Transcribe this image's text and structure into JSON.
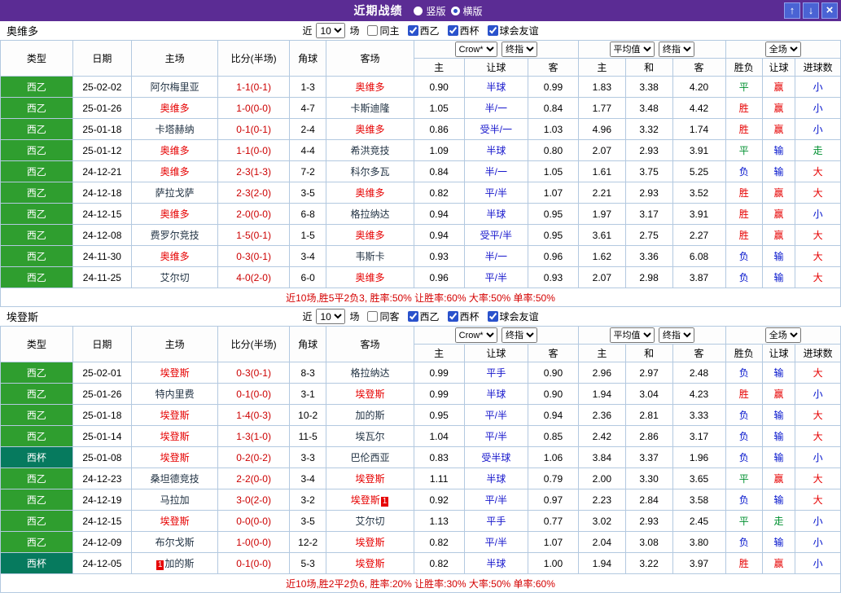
{
  "titlebar": {
    "title": "近期战绩",
    "radios": [
      {
        "label": "竖版",
        "selected": false
      },
      {
        "label": "横版",
        "selected": true
      }
    ],
    "up_icon": "↑",
    "down_icon": "↓",
    "close_icon": "×"
  },
  "labels": {
    "recent": "近",
    "matches": "场"
  },
  "header": {
    "type": "类型",
    "date": "日期",
    "home": "主场",
    "score": "比分(半场)",
    "corner": "角球",
    "away": "客场",
    "odds_select1": "Crow*",
    "odds_select2": "终指",
    "odds_home": "主",
    "odds_handicap": "让球",
    "odds_away": "客",
    "avg_select1": "平均值",
    "avg_select2": "终指",
    "avg_home": "主",
    "avg_draw": "和",
    "avg_away": "客",
    "result_select": "全场",
    "res_wdl": "胜负",
    "res_handicap": "让球",
    "res_goals": "进球数"
  },
  "colors": {
    "titlebar": "#5b2c94",
    "button_blue": "#4a63d4",
    "league_green": "#2f9e2f",
    "cup_teal": "#067a5e",
    "win_red": "#e60000",
    "lose_blue": "#0011cc",
    "draw_green": "#009030",
    "score_red": "#cc0000",
    "handicap_blue": "#1515cc"
  },
  "sections": [
    {
      "team": "奥维多",
      "count": "10",
      "checkboxes": [
        {
          "label": "同主",
          "checked": false
        },
        {
          "label": "西乙",
          "checked": true
        },
        {
          "label": "西杯",
          "checked": true
        },
        {
          "label": "球会友谊",
          "checked": true
        }
      ],
      "rows": [
        {
          "lg": "西乙",
          "lgc": "g",
          "date": "25-02-02",
          "home": "阿尔梅里亚",
          "home_f": false,
          "score": "1-1(0-1)",
          "corner": "1-3",
          "away": "奥维多",
          "away_f": true,
          "o1": "0.90",
          "hc": "半球",
          "o2": "0.99",
          "a1": "1.83",
          "a2": "3.38",
          "a3": "4.20",
          "r1": "平",
          "r2": "赢",
          "r3": "小"
        },
        {
          "lg": "西乙",
          "lgc": "g",
          "date": "25-01-26",
          "home": "奥维多",
          "home_f": true,
          "score": "1-0(0-0)",
          "corner": "4-7",
          "away": "卡斯迪隆",
          "away_f": false,
          "o1": "1.05",
          "hc": "半/一",
          "o2": "0.84",
          "a1": "1.77",
          "a2": "3.48",
          "a3": "4.42",
          "r1": "胜",
          "r2": "赢",
          "r3": "小"
        },
        {
          "lg": "西乙",
          "lgc": "g",
          "date": "25-01-18",
          "home": "卡塔赫纳",
          "home_f": false,
          "score": "0-1(0-1)",
          "corner": "2-4",
          "away": "奥维多",
          "away_f": true,
          "o1": "0.86",
          "hc": "受半/一",
          "o2": "1.03",
          "a1": "4.96",
          "a2": "3.32",
          "a3": "1.74",
          "r1": "胜",
          "r2": "赢",
          "r3": "小"
        },
        {
          "lg": "西乙",
          "lgc": "g",
          "date": "25-01-12",
          "home": "奥维多",
          "home_f": true,
          "score": "1-1(0-0)",
          "corner": "4-4",
          "away": "希洪竞技",
          "away_f": false,
          "o1": "1.09",
          "hc": "半球",
          "o2": "0.80",
          "a1": "2.07",
          "a2": "2.93",
          "a3": "3.91",
          "r1": "平",
          "r2": "输",
          "r3": "走"
        },
        {
          "lg": "西乙",
          "lgc": "g",
          "date": "24-12-21",
          "home": "奥维多",
          "home_f": true,
          "score": "2-3(1-3)",
          "corner": "7-2",
          "away": "科尔多瓦",
          "away_f": false,
          "o1": "0.84",
          "hc": "半/一",
          "o2": "1.05",
          "a1": "1.61",
          "a2": "3.75",
          "a3": "5.25",
          "r1": "负",
          "r2": "输",
          "r3": "大"
        },
        {
          "lg": "西乙",
          "lgc": "g",
          "date": "24-12-18",
          "home": "萨拉戈萨",
          "home_f": false,
          "score": "2-3(2-0)",
          "corner": "3-5",
          "away": "奥维多",
          "away_f": true,
          "o1": "0.82",
          "hc": "平/半",
          "o2": "1.07",
          "a1": "2.21",
          "a2": "2.93",
          "a3": "3.52",
          "r1": "胜",
          "r2": "赢",
          "r3": "大"
        },
        {
          "lg": "西乙",
          "lgc": "g",
          "date": "24-12-15",
          "home": "奥维多",
          "home_f": true,
          "score": "2-0(0-0)",
          "corner": "6-8",
          "away": "格拉纳达",
          "away_f": false,
          "o1": "0.94",
          "hc": "半球",
          "o2": "0.95",
          "a1": "1.97",
          "a2": "3.17",
          "a3": "3.91",
          "r1": "胜",
          "r2": "赢",
          "r3": "小"
        },
        {
          "lg": "西乙",
          "lgc": "g",
          "date": "24-12-08",
          "home": "费罗尔竞技",
          "home_f": false,
          "score": "1-5(0-1)",
          "corner": "1-5",
          "away": "奥维多",
          "away_f": true,
          "o1": "0.94",
          "hc": "受平/半",
          "o2": "0.95",
          "a1": "3.61",
          "a2": "2.75",
          "a3": "2.27",
          "r1": "胜",
          "r2": "赢",
          "r3": "大"
        },
        {
          "lg": "西乙",
          "lgc": "g",
          "date": "24-11-30",
          "home": "奥维多",
          "home_f": true,
          "score": "0-3(0-1)",
          "corner": "3-4",
          "away": "韦斯卡",
          "away_f": false,
          "o1": "0.93",
          "hc": "半/一",
          "o2": "0.96",
          "a1": "1.62",
          "a2": "3.36",
          "a3": "6.08",
          "r1": "负",
          "r2": "输",
          "r3": "大"
        },
        {
          "lg": "西乙",
          "lgc": "g",
          "date": "24-11-25",
          "home": "艾尔切",
          "home_f": false,
          "score": "4-0(2-0)",
          "corner": "6-0",
          "away": "奥维多",
          "away_f": true,
          "o1": "0.96",
          "hc": "平/半",
          "o2": "0.93",
          "a1": "2.07",
          "a2": "2.98",
          "a3": "3.87",
          "r1": "负",
          "r2": "输",
          "r3": "大"
        }
      ],
      "summary": "近10场,胜5平2负3, 胜率:50% 让胜率:60% 大率:50% 单率:50%"
    },
    {
      "team": "埃登斯",
      "count": "10",
      "checkboxes": [
        {
          "label": "同客",
          "checked": false
        },
        {
          "label": "西乙",
          "checked": true
        },
        {
          "label": "西杯",
          "checked": true
        },
        {
          "label": "球会友谊",
          "checked": true
        }
      ],
      "rows": [
        {
          "lg": "西乙",
          "lgc": "g",
          "date": "25-02-01",
          "home": "埃登斯",
          "home_f": true,
          "score": "0-3(0-1)",
          "corner": "8-3",
          "away": "格拉纳达",
          "away_f": false,
          "o1": "0.99",
          "hc": "平手",
          "o2": "0.90",
          "a1": "2.96",
          "a2": "2.97",
          "a3": "2.48",
          "r1": "负",
          "r2": "输",
          "r3": "大"
        },
        {
          "lg": "西乙",
          "lgc": "g",
          "date": "25-01-26",
          "home": "特内里费",
          "home_f": false,
          "score": "0-1(0-0)",
          "corner": "3-1",
          "away": "埃登斯",
          "away_f": true,
          "o1": "0.99",
          "hc": "半球",
          "o2": "0.90",
          "a1": "1.94",
          "a2": "3.04",
          "a3": "4.23",
          "r1": "胜",
          "r2": "赢",
          "r3": "小"
        },
        {
          "lg": "西乙",
          "lgc": "g",
          "date": "25-01-18",
          "home": "埃登斯",
          "home_f": true,
          "score": "1-4(0-3)",
          "corner": "10-2",
          "away": "加的斯",
          "away_f": false,
          "o1": "0.95",
          "hc": "平/半",
          "o2": "0.94",
          "a1": "2.36",
          "a2": "2.81",
          "a3": "3.33",
          "r1": "负",
          "r2": "输",
          "r3": "大"
        },
        {
          "lg": "西乙",
          "lgc": "g",
          "date": "25-01-14",
          "home": "埃登斯",
          "home_f": true,
          "score": "1-3(1-0)",
          "corner": "11-5",
          "away": "埃瓦尔",
          "away_f": false,
          "o1": "1.04",
          "hc": "平/半",
          "o2": "0.85",
          "a1": "2.42",
          "a2": "2.86",
          "a3": "3.17",
          "r1": "负",
          "r2": "输",
          "r3": "大"
        },
        {
          "lg": "西杯",
          "lgc": "t",
          "date": "25-01-08",
          "home": "埃登斯",
          "home_f": true,
          "score": "0-2(0-2)",
          "corner": "3-3",
          "away": "巴伦西亚",
          "away_f": false,
          "o1": "0.83",
          "hc": "受半球",
          "o2": "1.06",
          "a1": "3.84",
          "a2": "3.37",
          "a3": "1.96",
          "r1": "负",
          "r2": "输",
          "r3": "小"
        },
        {
          "lg": "西乙",
          "lgc": "g",
          "date": "24-12-23",
          "home": "桑坦德竞技",
          "home_f": false,
          "score": "2-2(0-0)",
          "corner": "3-4",
          "away": "埃登斯",
          "away_f": true,
          "o1": "1.11",
          "hc": "半球",
          "o2": "0.79",
          "a1": "2.00",
          "a2": "3.30",
          "a3": "3.65",
          "r1": "平",
          "r2": "赢",
          "r3": "大"
        },
        {
          "lg": "西乙",
          "lgc": "g",
          "date": "24-12-19",
          "home": "马拉加",
          "home_f": false,
          "score": "3-0(2-0)",
          "corner": "3-2",
          "away": "埃登斯",
          "away_f": true,
          "away_b": "1",
          "away_bp": "after",
          "o1": "0.92",
          "hc": "平/半",
          "o2": "0.97",
          "a1": "2.23",
          "a2": "2.84",
          "a3": "3.58",
          "r1": "负",
          "r2": "输",
          "r3": "大"
        },
        {
          "lg": "西乙",
          "lgc": "g",
          "date": "24-12-15",
          "home": "埃登斯",
          "home_f": true,
          "score": "0-0(0-0)",
          "corner": "3-5",
          "away": "艾尔切",
          "away_f": false,
          "o1": "1.13",
          "hc": "平手",
          "o2": "0.77",
          "a1": "3.02",
          "a2": "2.93",
          "a3": "2.45",
          "r1": "平",
          "r2": "走",
          "r3": "小"
        },
        {
          "lg": "西乙",
          "lgc": "g",
          "date": "24-12-09",
          "home": "布尔戈斯",
          "home_f": false,
          "score": "1-0(0-0)",
          "corner": "12-2",
          "away": "埃登斯",
          "away_f": true,
          "o1": "0.82",
          "hc": "平/半",
          "o2": "1.07",
          "a1": "2.04",
          "a2": "3.08",
          "a3": "3.80",
          "r1": "负",
          "r2": "输",
          "r3": "小"
        },
        {
          "lg": "西杯",
          "lgc": "t",
          "date": "24-12-05",
          "home": "加的斯",
          "home_f": false,
          "home_b": "1",
          "home_bp": "before",
          "score": "0-1(0-0)",
          "corner": "5-3",
          "away": "埃登斯",
          "away_f": true,
          "o1": "0.82",
          "hc": "半球",
          "o2": "1.00",
          "a1": "1.94",
          "a2": "3.22",
          "a3": "3.97",
          "r1": "胜",
          "r2": "赢",
          "r3": "小"
        }
      ],
      "summary": "近10场,胜2平2负6, 胜率:20% 让胜率:30% 大率:50% 单率:60%"
    }
  ]
}
